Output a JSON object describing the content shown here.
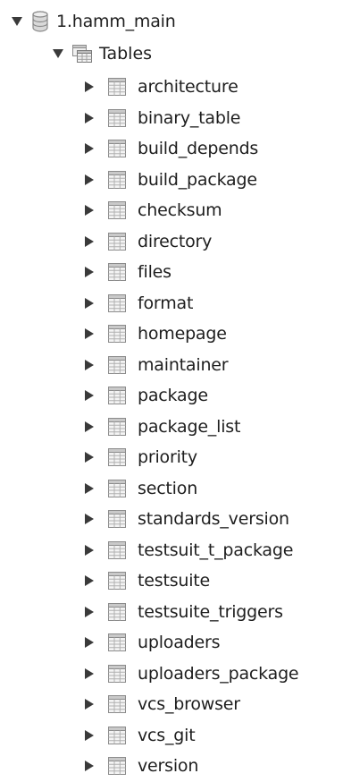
{
  "tree": {
    "database": {
      "name": "1.hamm_main",
      "expanded": true,
      "icon": "database-icon"
    },
    "tables_folder": {
      "label": "Tables",
      "expanded": true,
      "icon": "tables-folder-icon"
    },
    "tables": [
      {
        "name": "architecture"
      },
      {
        "name": "binary_table"
      },
      {
        "name": "build_depends"
      },
      {
        "name": "build_package"
      },
      {
        "name": "checksum"
      },
      {
        "name": "directory"
      },
      {
        "name": "files"
      },
      {
        "name": "format"
      },
      {
        "name": "homepage"
      },
      {
        "name": "maintainer"
      },
      {
        "name": "package"
      },
      {
        "name": "package_list"
      },
      {
        "name": "priority"
      },
      {
        "name": "section"
      },
      {
        "name": "standards_version"
      },
      {
        "name": "testsuit_t_package"
      },
      {
        "name": "testsuite"
      },
      {
        "name": "testsuite_triggers"
      },
      {
        "name": "uploaders"
      },
      {
        "name": "uploaders_package"
      },
      {
        "name": "vcs_browser"
      },
      {
        "name": "vcs_git"
      },
      {
        "name": "version"
      }
    ]
  },
  "colors": {
    "arrow": "#3a3a3a",
    "text": "#1e1e1e",
    "table_icon_border": "#8c8c8c",
    "table_icon_fill": "#f4f4f4",
    "table_icon_header": "#c9c9c9"
  }
}
